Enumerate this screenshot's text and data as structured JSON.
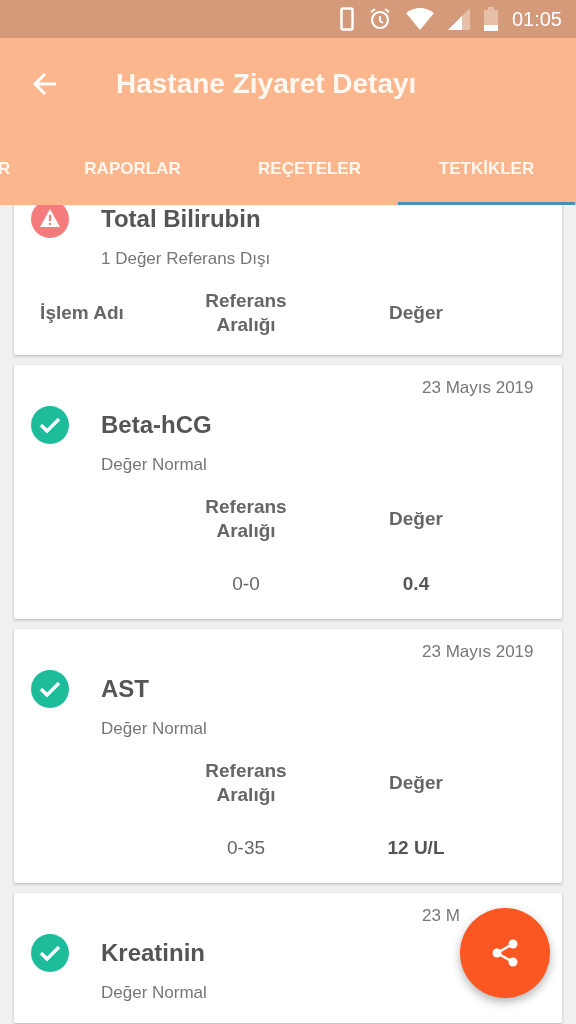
{
  "status_bar": {
    "time": "01:05"
  },
  "app_bar": {
    "title": "Hastane Ziyaret Detayı"
  },
  "tabs": [
    {
      "label": "R",
      "selected": false
    },
    {
      "label": "RAPORLAR",
      "selected": false
    },
    {
      "label": "REÇETELER",
      "selected": false
    },
    {
      "label": "TETKİKLER",
      "selected": true
    }
  ],
  "results": [
    {
      "kind": "alert",
      "title": "Total Bilirubin",
      "summary": "1 Değer Referans Dışı",
      "headers": {
        "name": "İşlem Adı",
        "range": "Referans Aralığı",
        "value": "Değer"
      }
    },
    {
      "kind": "ok",
      "date": "23 Mayıs 2019",
      "title": "Beta-hCG",
      "summary": "Değer Normal",
      "headers": {
        "range": "Referans Aralığı",
        "value": "Değer"
      },
      "rows": [
        {
          "range": "0-0",
          "value": "0.4"
        }
      ]
    },
    {
      "kind": "ok",
      "date": "23 Mayıs 2019",
      "title": "AST",
      "summary": "Değer Normal",
      "headers": {
        "range": "Referans Aralığı",
        "value": "Değer"
      },
      "rows": [
        {
          "range": "0-35",
          "value": "12 U/L"
        }
      ]
    },
    {
      "kind": "ok",
      "date": "23 M",
      "title": "Kreatinin",
      "summary": "Değer Normal"
    }
  ]
}
